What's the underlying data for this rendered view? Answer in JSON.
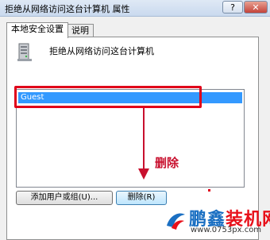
{
  "window": {
    "title": "拒绝从网络访问这台计算机 属性",
    "help_label": "?",
    "close_label": "✕"
  },
  "tabs": [
    {
      "label": "本地安全设置",
      "active": true
    },
    {
      "label": "说明",
      "active": false
    }
  ],
  "policy": {
    "icon": "server-computer-icon",
    "name": "拒绝从网络访问这台计算机"
  },
  "list": {
    "items": [
      {
        "label": "Guest",
        "selected": true
      }
    ]
  },
  "buttons": {
    "add": "添加用户或组(U)...",
    "delete": "删除(R)"
  },
  "annotation": {
    "text": "删除",
    "color": "#c8102e"
  },
  "watermark": {
    "brand_part1": "鹏鑫",
    "brand_part2": "装机网",
    "url": "www.0753px.com"
  },
  "colors": {
    "selection": "#3399ff",
    "highlight_box": "#e0001a"
  }
}
